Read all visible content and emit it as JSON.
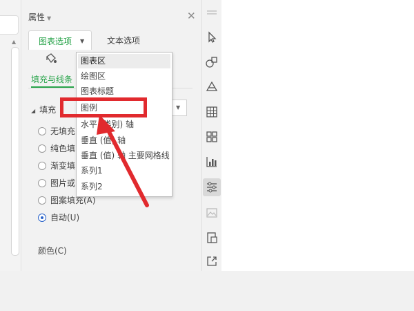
{
  "panel": {
    "title": "属性",
    "tabs": {
      "chart_options": "图表选项",
      "text_options": "文本选项"
    },
    "sub_tab": "填充与线条",
    "fill_section": "填充",
    "fill_options": [
      {
        "label": "无填充",
        "selected": false
      },
      {
        "label": "纯色填",
        "selected": false
      },
      {
        "label": "渐变填",
        "selected": false
      },
      {
        "label": "图片或",
        "selected": false
      },
      {
        "label": "图案填充(A)",
        "selected": false
      },
      {
        "label": "自动(U)",
        "selected": true
      }
    ],
    "color_label": "颜色(C)"
  },
  "dropdown": {
    "items": [
      {
        "label": "图表区",
        "selected": true
      },
      {
        "label": "绘图区",
        "selected": false
      },
      {
        "label": "图表标题",
        "selected": false
      },
      {
        "label": "图例",
        "selected": false
      },
      {
        "label": "水平 (类别) 轴",
        "selected": false
      },
      {
        "label": "垂直 (值) 轴",
        "selected": false
      },
      {
        "label": "垂直 (值) 轴 主要网格线",
        "selected": false
      },
      {
        "label": "系列1",
        "selected": false
      },
      {
        "label": "系列2",
        "selected": false
      }
    ],
    "highlighted_item": "图例"
  },
  "toolbar": {
    "icons": [
      "select-arrow-icon",
      "shapes-icon",
      "fill-icon",
      "table-icon",
      "grid-icon",
      "chart-icon",
      "properties-icon",
      "image-icon",
      "page-icon",
      "export-icon"
    ],
    "active": "properties-icon"
  },
  "colors": {
    "accent_green": "#27a349",
    "annotation_red": "#e12a2e",
    "radio_blue": "#2a63c9"
  }
}
